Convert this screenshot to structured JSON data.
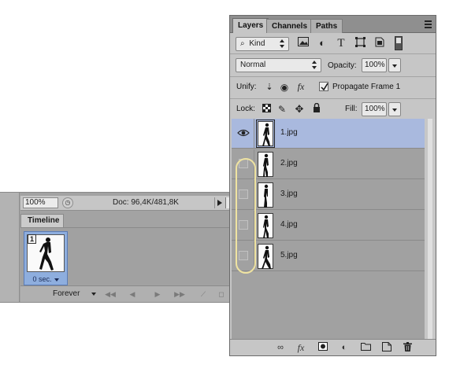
{
  "status_bar": {
    "zoom": "100%",
    "doc_info": "Doc: 96,4K/481,8K"
  },
  "timeline": {
    "tab_label": "Timeline",
    "frames": [
      {
        "number": "1",
        "delay": "0 sec."
      }
    ],
    "loop_option": "Forever",
    "controls": [
      "first-frame-icon",
      "previous-frame-icon",
      "play-icon",
      "next-frame-icon",
      "tween-icon"
    ]
  },
  "layers_panel": {
    "tabs": [
      {
        "label": "Layers",
        "active": true
      },
      {
        "label": "Channels",
        "active": false
      },
      {
        "label": "Paths",
        "active": false
      }
    ],
    "filter": {
      "kind_label": "Kind",
      "icons": [
        "image-filter-icon",
        "adjustment-filter-icon",
        "type-filter-icon",
        "shape-filter-icon",
        "smart-object-filter-icon"
      ]
    },
    "blend_mode": "Normal",
    "opacity_label": "Opacity:",
    "opacity_value": "100%",
    "unify_label": "Unify:",
    "propagate_label": "Propagate Frame 1",
    "propagate_checked": true,
    "lock_label": "Lock:",
    "fill_label": "Fill:",
    "fill_value": "100%",
    "layers": [
      {
        "name": "1.jpg",
        "visible": true,
        "selected": true
      },
      {
        "name": "2.jpg",
        "visible": false,
        "selected": false
      },
      {
        "name": "3.jpg",
        "visible": false,
        "selected": false
      },
      {
        "name": "4.jpg",
        "visible": false,
        "selected": false
      },
      {
        "name": "5.jpg",
        "visible": false,
        "selected": false
      }
    ],
    "bottom_icons": [
      "link-layers-icon",
      "fx-icon",
      "add-mask-icon",
      "adjustment-layer-icon",
      "new-group-icon",
      "new-layer-icon",
      "delete-layer-icon"
    ]
  },
  "colors": {
    "selected_row": "#a9b9de",
    "highlight_oval": "#efe3a1",
    "panel_bg": "#c6c6c6"
  }
}
